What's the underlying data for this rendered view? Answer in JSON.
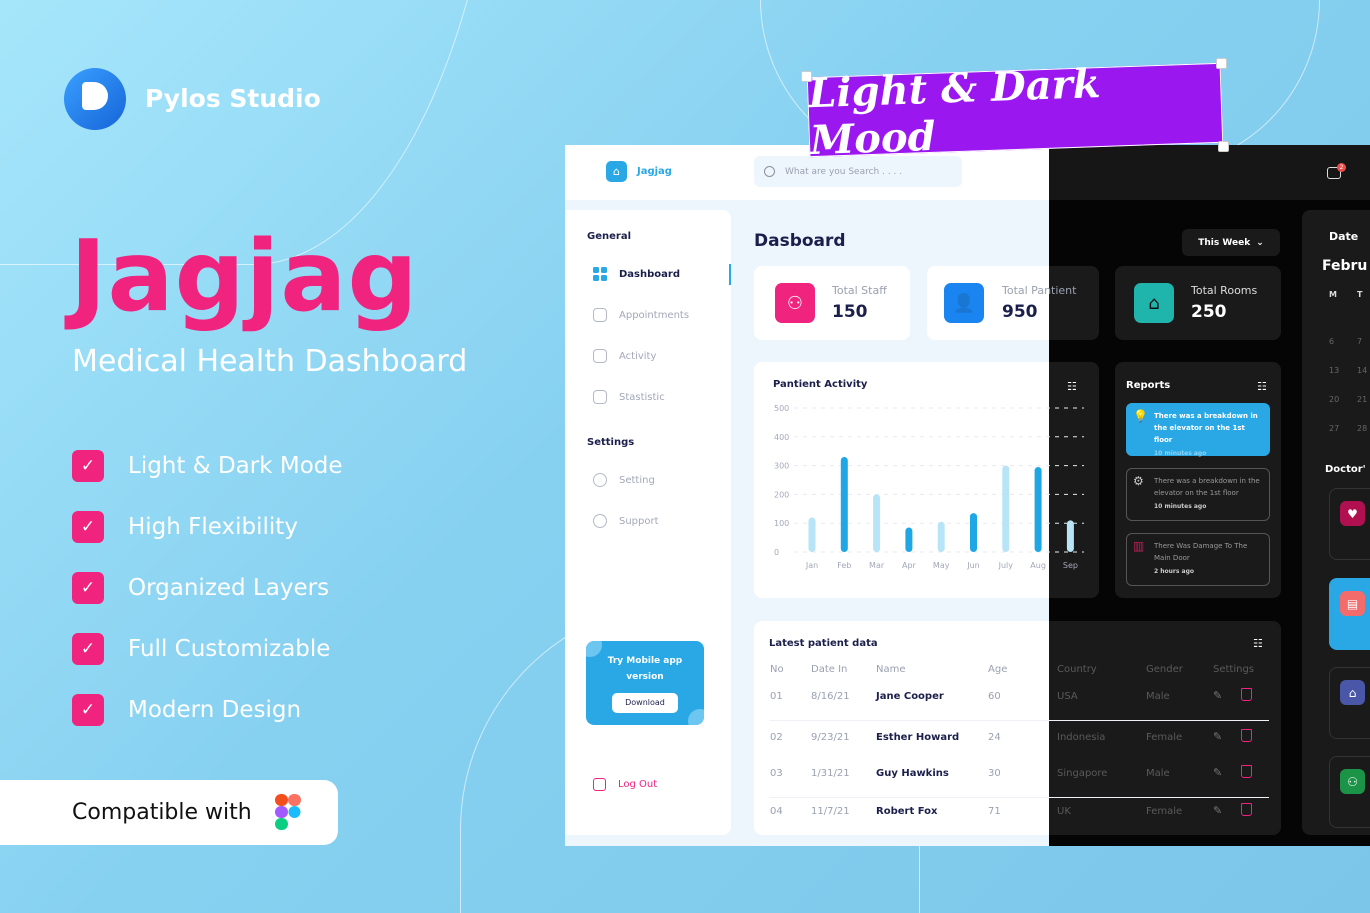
{
  "brand": {
    "name": "Pylos Studio"
  },
  "hero": {
    "title": "Jagjag",
    "subtitle": "Medical Health Dashboard"
  },
  "features": [
    "Light & Dark Mode",
    "High Flexibility",
    "Organized Layers",
    "Full Customizable",
    "Modern Design"
  ],
  "compatible": {
    "label": "Compatible with",
    "tool_icon": "figma-logo"
  },
  "banner": {
    "text": "Light & Dark Mood"
  },
  "colors": {
    "accent_pink": "#f0237f",
    "primary_blue": "#2aa8e6",
    "banner_purple": "#9a17f0"
  },
  "app": {
    "logo_text": "Jagjag",
    "search": {
      "placeholder": "What are you Search . . . ."
    },
    "notifications_count": "2",
    "sidebar": {
      "general_label": "General",
      "general_items": [
        {
          "label": "Dashboard",
          "icon": "grid-icon",
          "active": true
        },
        {
          "label": "Appointments",
          "icon": "document-icon"
        },
        {
          "label": "Activity",
          "icon": "pie-chart-icon"
        },
        {
          "label": "Stastistic",
          "icon": "bar-chart-icon"
        }
      ],
      "settings_label": "Settings",
      "settings_items": [
        {
          "label": "Setting",
          "icon": "gear-icon"
        },
        {
          "label": "Support",
          "icon": "users-icon"
        }
      ],
      "promo": {
        "text": "Try Mobile app version",
        "button": "Download"
      },
      "logout": "Log Out"
    },
    "page_title": "Dasboard",
    "period_select": "This Week",
    "stats": [
      {
        "label": "Total Staff",
        "value": "150",
        "color": "#f0237f"
      },
      {
        "label": "Total Pantient",
        "value": "950",
        "color": "#1a84f0"
      },
      {
        "label": "Total Rooms",
        "value": "250",
        "color": "#1fb5ad"
      }
    ],
    "reports": {
      "title": "Reports",
      "items": [
        {
          "text": "There was a breakdown in the elevator on the 1st floor",
          "time": "10 minutes ago",
          "icon": "lightbulb-icon",
          "highlight": true
        },
        {
          "text": "There was a breakdown in the elevator on the 1st floor",
          "time": "10 minutes ago",
          "icon": "gear-icon"
        },
        {
          "text": "There Was Damage To The Main Door",
          "time": "2 hours ago",
          "icon": "door-icon"
        }
      ]
    },
    "calendar": {
      "title": "Date",
      "month": "Febru",
      "weekdays": [
        "M",
        "T"
      ],
      "rows": [
        [
          "6",
          "7"
        ],
        [
          "13",
          "14"
        ],
        [
          "20",
          "21"
        ],
        [
          "27",
          "28"
        ]
      ]
    },
    "doctors_title": "Doctor'",
    "table": {
      "title": "Latest patient data",
      "columns": [
        "No",
        "Date In",
        "Name",
        "Age",
        "Country",
        "Gender",
        "Settings"
      ],
      "rows": [
        [
          "01",
          "8/16/21",
          "Jane Cooper",
          "60",
          "USA",
          "Male"
        ],
        [
          "02",
          "9/23/21",
          "Esther Howard",
          "24",
          "Indonesia",
          "Female"
        ],
        [
          "03",
          "1/31/21",
          "Guy Hawkins",
          "30",
          "Singapore",
          "Male"
        ],
        [
          "04",
          "11/7/21",
          "Robert Fox",
          "71",
          "UK",
          "Female"
        ]
      ]
    }
  },
  "chart_data": {
    "type": "bar",
    "title": "Pantient Activity",
    "categories": [
      "Jan",
      "Feb",
      "Mar",
      "Apr",
      "May",
      "Jun",
      "July",
      "Aug",
      "Sep"
    ],
    "values": [
      120,
      330,
      200,
      85,
      105,
      135,
      300,
      295,
      110
    ],
    "highlighted": [
      false,
      true,
      false,
      true,
      false,
      true,
      false,
      true,
      false
    ],
    "yticks": [
      0,
      100,
      200,
      300,
      400,
      500
    ],
    "ylim": [
      0,
      500
    ],
    "grid": true
  }
}
